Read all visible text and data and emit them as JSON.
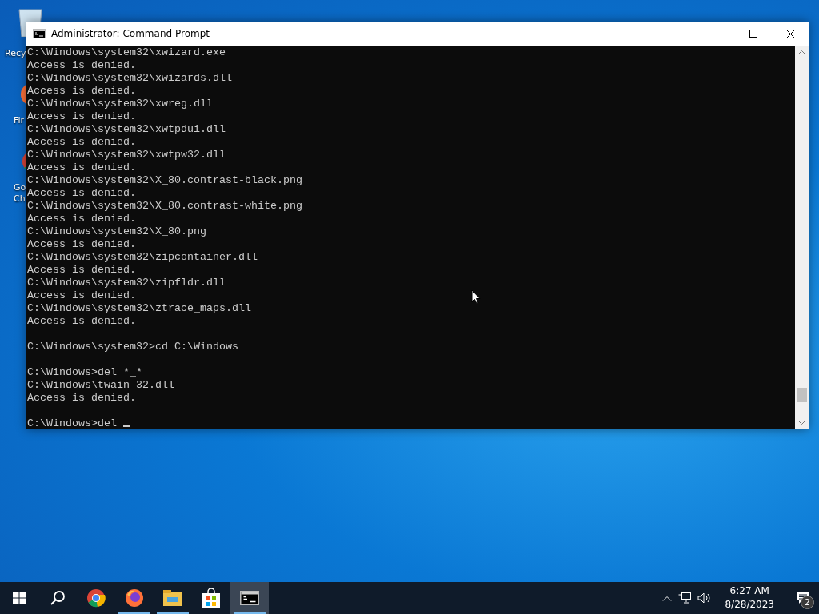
{
  "desktop_icons": [
    {
      "kind": "bin",
      "label": [
        "Recy"
      ]
    },
    {
      "kind": "firefox",
      "label": [
        "Fir"
      ]
    },
    {
      "kind": "chrome",
      "label": [
        "Go",
        "Ch"
      ]
    }
  ],
  "window": {
    "title": "Administrator:  Command Prompt",
    "console": [
      {
        "kind": "text",
        "text": "C:\\Windows\\system32\\xwizard.exe"
      },
      {
        "kind": "text",
        "text": "Access is denied."
      },
      {
        "kind": "text",
        "text": "C:\\Windows\\system32\\xwizards.dll"
      },
      {
        "kind": "text",
        "text": "Access is denied."
      },
      {
        "kind": "text",
        "text": "C:\\Windows\\system32\\xwreg.dll"
      },
      {
        "kind": "text",
        "text": "Access is denied."
      },
      {
        "kind": "text",
        "text": "C:\\Windows\\system32\\xwtpdui.dll"
      },
      {
        "kind": "text",
        "text": "Access is denied."
      },
      {
        "kind": "text",
        "text": "C:\\Windows\\system32\\xwtpw32.dll"
      },
      {
        "kind": "text",
        "text": "Access is denied."
      },
      {
        "kind": "text",
        "text": "C:\\Windows\\system32\\X_80.contrast-black.png"
      },
      {
        "kind": "text",
        "text": "Access is denied."
      },
      {
        "kind": "text",
        "text": "C:\\Windows\\system32\\X_80.contrast-white.png"
      },
      {
        "kind": "text",
        "text": "Access is denied."
      },
      {
        "kind": "text",
        "text": "C:\\Windows\\system32\\X_80.png"
      },
      {
        "kind": "text",
        "text": "Access is denied."
      },
      {
        "kind": "text",
        "text": "C:\\Windows\\system32\\zipcontainer.dll"
      },
      {
        "kind": "text",
        "text": "Access is denied."
      },
      {
        "kind": "text",
        "text": "C:\\Windows\\system32\\zipfldr.dll"
      },
      {
        "kind": "text",
        "text": "Access is denied."
      },
      {
        "kind": "text",
        "text": "C:\\Windows\\system32\\ztrace_maps.dll"
      },
      {
        "kind": "text",
        "text": "Access is denied."
      },
      {
        "kind": "blank"
      },
      {
        "kind": "text",
        "text": "C:\\Windows\\system32>cd C:\\Windows"
      },
      {
        "kind": "blank"
      },
      {
        "kind": "text",
        "text": "C:\\Windows>del *_*"
      },
      {
        "kind": "text",
        "text": "C:\\Windows\\twain_32.dll"
      },
      {
        "kind": "text",
        "text": "Access is denied."
      },
      {
        "kind": "blank"
      },
      {
        "kind": "prompt",
        "text": "C:\\Windows>del "
      }
    ]
  },
  "taskbar": {
    "apps": [
      {
        "kind": "chrome",
        "running": false,
        "selected": false
      },
      {
        "kind": "firefox",
        "running": true,
        "selected": false
      },
      {
        "kind": "explorer",
        "running": true,
        "selected": false
      },
      {
        "kind": "store",
        "running": false,
        "selected": false
      },
      {
        "kind": "cmd",
        "running": true,
        "selected": true
      }
    ],
    "time": "6:27 AM",
    "date": "8/28/2023",
    "notifications": "2"
  }
}
